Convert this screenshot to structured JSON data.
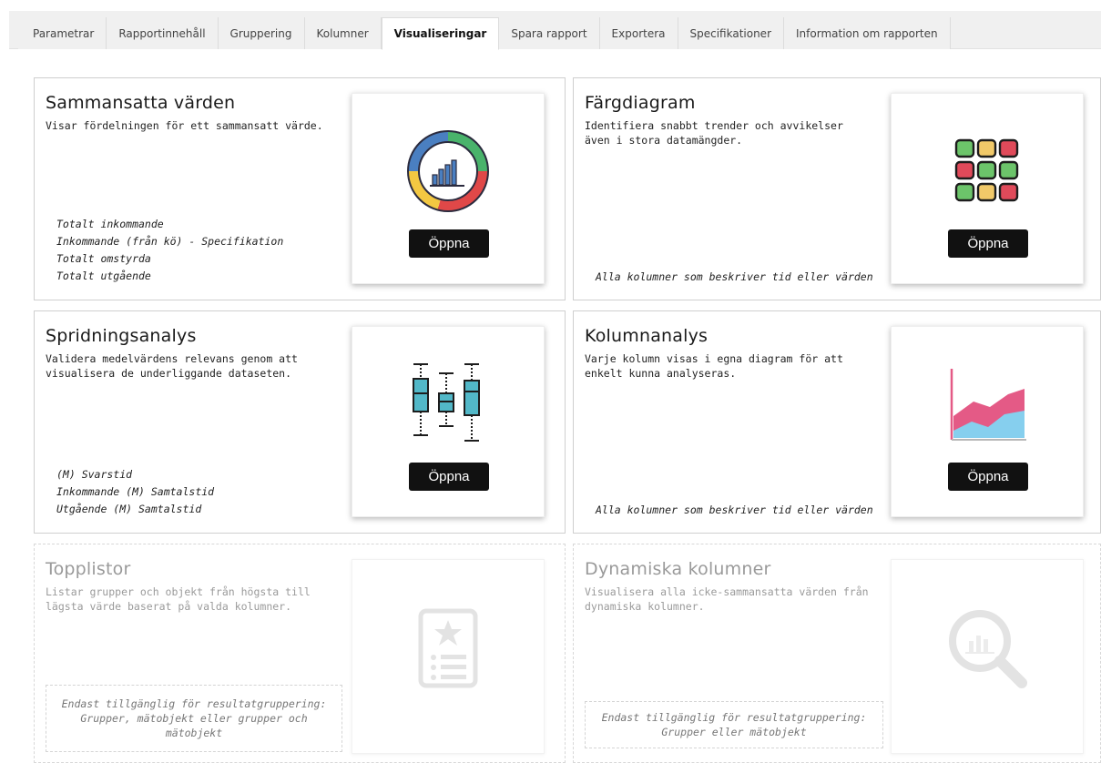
{
  "tabs": [
    {
      "label": "Parametrar"
    },
    {
      "label": "Rapportinnehåll"
    },
    {
      "label": "Gruppering"
    },
    {
      "label": "Kolumner"
    },
    {
      "label": "Visualiseringar",
      "active": true
    },
    {
      "label": "Spara rapport"
    },
    {
      "label": "Exportera"
    },
    {
      "label": "Specifikationer"
    },
    {
      "label": "Information om rapporten"
    }
  ],
  "cards": {
    "sammansatta": {
      "title": "Sammansatta värden",
      "description": "Visar fördelningen för ett sammansatt värde.",
      "icon": "donut-chart-icon",
      "button": "Öppna",
      "columns": [
        "Totalt inkommande",
        "Inkommande (från kö) - Specifikation",
        "Totalt omstyrda",
        "Totalt utgående"
      ]
    },
    "fargdiagram": {
      "title": "Färgdiagram",
      "description": "Identifiera snabbt trender och avvikelser även i stora datamängder.",
      "icon": "color-grid-icon",
      "button": "Öppna",
      "note": "Alla kolumner som beskriver tid eller värden"
    },
    "spridning": {
      "title": "Spridningsanalys",
      "description": "Validera medelvärdens relevans genom att visualisera de underliggande dataseten.",
      "icon": "box-plot-icon",
      "button": "Öppna",
      "columns": [
        "(M) Svarstid",
        "Inkommande (M) Samtalstid",
        "Utgående (M) Samtalstid"
      ]
    },
    "kolumnanalys": {
      "title": "Kolumnanalys",
      "description": "Varje kolumn visas i egna diagram för att enkelt kunna analyseras.",
      "icon": "area-chart-icon",
      "button": "Öppna",
      "note": "Alla kolumner som beskriver tid eller värden"
    },
    "topplistor": {
      "title": "Topplistor",
      "description": "Listar grupper och objekt från högsta till lägsta värde baserat på valda kolumner.",
      "icon": "ranked-list-icon",
      "availability": "Endast tillgänglig för resultatgruppering: Grupper, mätobjekt eller grupper och mätobjekt"
    },
    "dynamiska": {
      "title": "Dynamiska kolumner",
      "description": "Visualisera alla icke-sammansatta värden från dynamiska kolumner.",
      "icon": "magnifier-chart-icon",
      "availability": "Endast tillgänglig för resultatgruppering: Grupper eller mätobjekt"
    }
  },
  "colors": {
    "donut": [
      "#4a7fc1",
      "#49b36b",
      "#e04848",
      "#f3c842"
    ],
    "grid": [
      "#6cc46a",
      "#f1c969",
      "#e04a5a"
    ],
    "box": "#52b8c8",
    "area_pink": "#e45a86",
    "area_blue": "#86cfee"
  }
}
